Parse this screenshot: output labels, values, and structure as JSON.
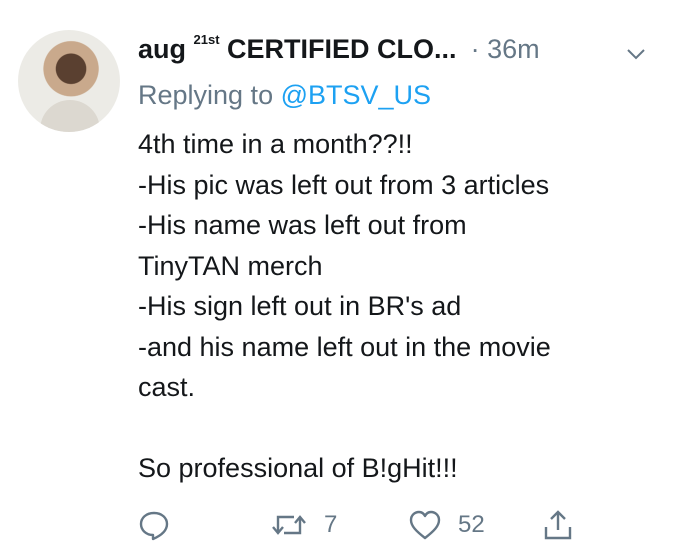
{
  "tweet": {
    "name_prefix": "aug ",
    "name_sup": "21st",
    "name_main": " CERTIFIED CLO...",
    "separator": "·",
    "time": "36m",
    "replying_label": "Replying to ",
    "replying_handle": "@BTSV_US",
    "lines": [
      "4th time in a month??!!",
      "-His pic was left out from 3 articles",
      "-His name was left out from",
      "TinyTAN merch",
      "-His sign left out in BR's ad",
      "-and his name left out in the movie",
      "cast."
    ],
    "closing": "So professional of B!gHit!!!"
  },
  "actions": {
    "reply_icon": "reply-bubble-icon",
    "retweet_icon": "retweet-icon",
    "retweet_count": "7",
    "like_icon": "heart-icon",
    "like_count": "52",
    "share_icon": "share-icon"
  },
  "colors": {
    "text": "#14171a",
    "secondary": "#657786",
    "link": "#1da1f2"
  }
}
